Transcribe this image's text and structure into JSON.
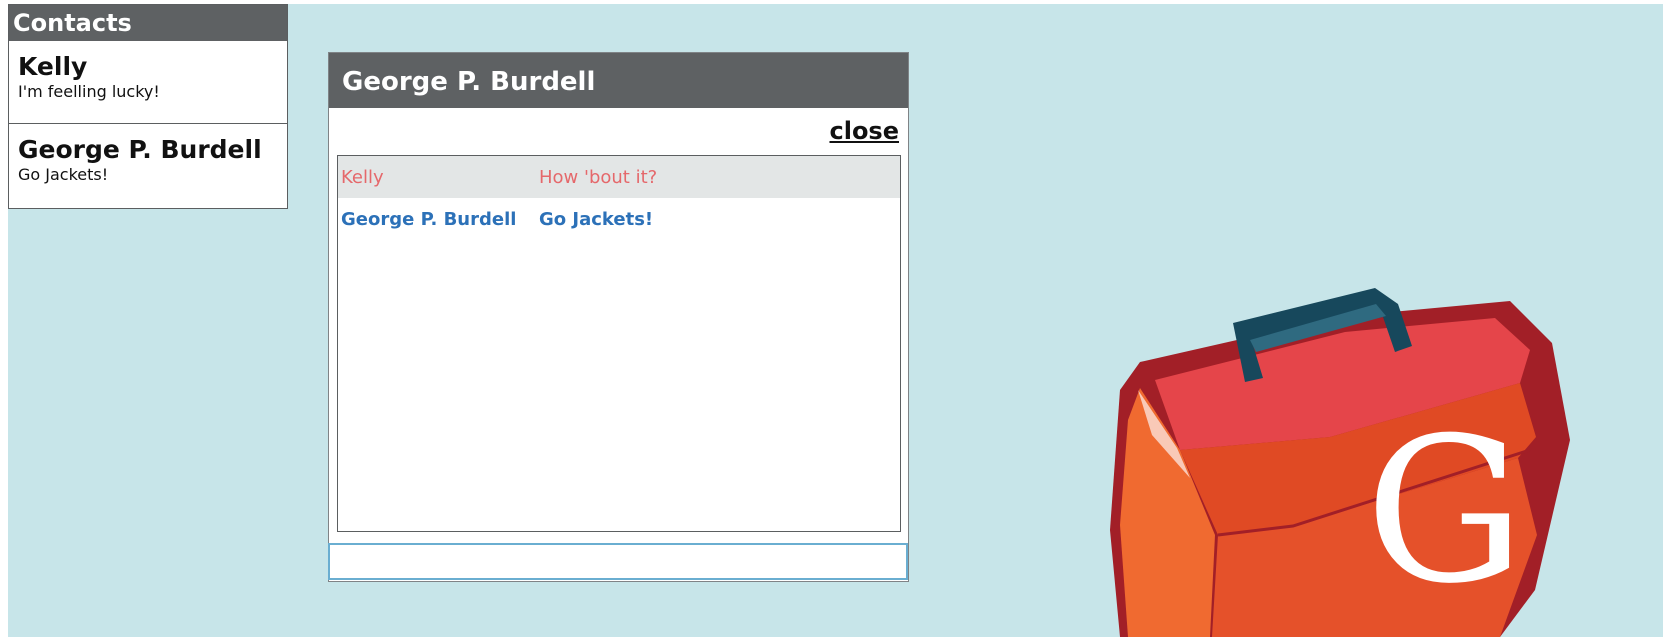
{
  "contacts": {
    "title": "Contacts",
    "items": [
      {
        "name": "Kelly",
        "status": "I'm feelling lucky!"
      },
      {
        "name": "George P. Burdell",
        "status": "Go Jackets!"
      }
    ]
  },
  "chat": {
    "title": "George P. Burdell",
    "close_label": "close",
    "messages": [
      {
        "sender": "Kelly",
        "text": "How 'bout it?",
        "color": "#e5686b"
      },
      {
        "sender": "George P. Burdell",
        "text": "Go Jackets!",
        "color": "#2c71b8"
      }
    ],
    "input": {
      "value": "",
      "placeholder": ""
    }
  },
  "logo": {
    "letter": "G"
  },
  "colors": {
    "background": "#c7e5e9",
    "header": "#5e6163",
    "kelly": "#e5686b",
    "george": "#2c71b8",
    "input_border": "#6aaed1"
  }
}
